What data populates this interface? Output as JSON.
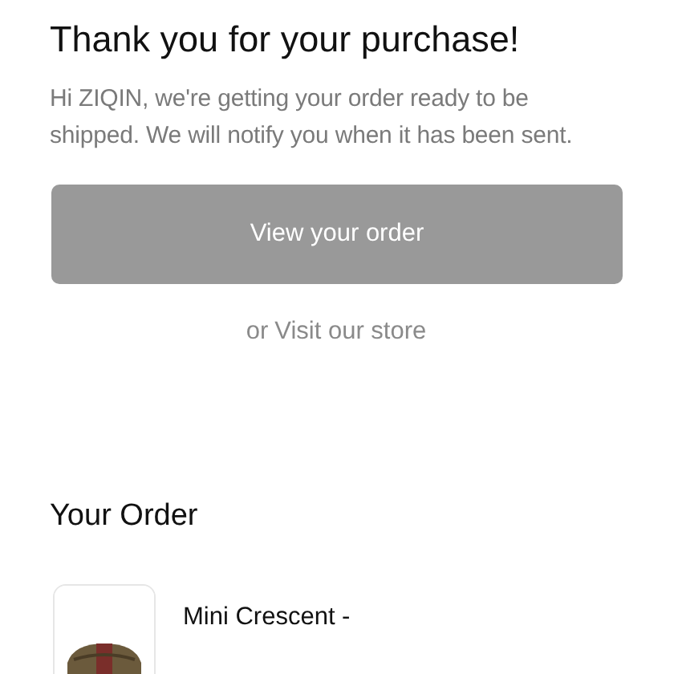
{
  "heading": "Thank you for your purchase!",
  "message": "Hi ZIQIN, we're getting your order ready to be shipped. We will notify you when it has been sent.",
  "primary_button": "View your order",
  "secondary": {
    "prefix": "or",
    "link": "Visit our store"
  },
  "order": {
    "title": "Your Order",
    "items": [
      {
        "name": "Mini Crescent -"
      }
    ]
  }
}
